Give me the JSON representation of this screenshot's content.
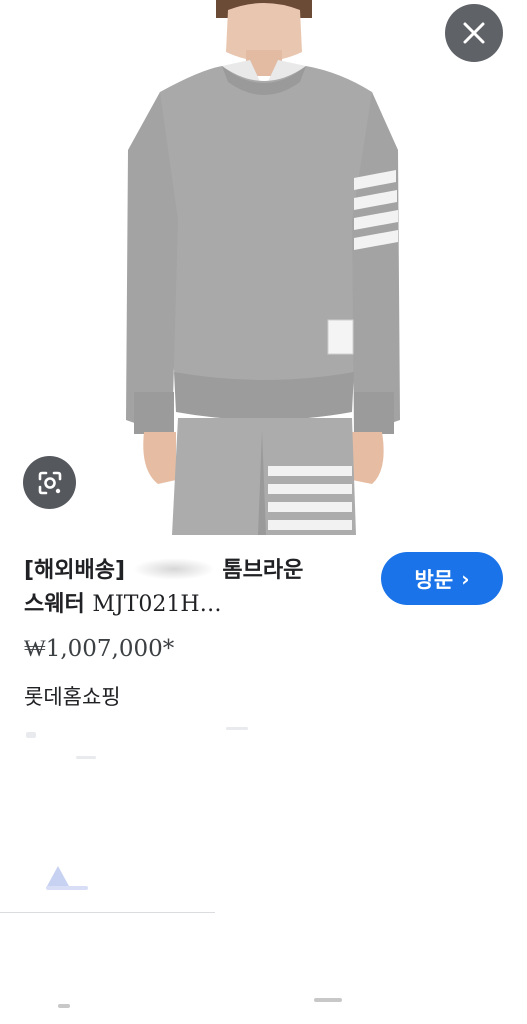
{
  "product": {
    "title_prefix": "[해외배송]",
    "brand": "톰브라운",
    "title_line2_korean": "스웨터",
    "title_line2_code": "MJT021H…",
    "price": "₩1,007,000*",
    "seller": "롯데홈쇼핑"
  },
  "actions": {
    "visit_label": "방문",
    "visit_chevron": "›"
  },
  "icons": {
    "close": "close-icon",
    "lens": "lens-icon"
  },
  "colors": {
    "visit_button": "#1a73e8",
    "close_button": "#5f6368",
    "lens_button": "#55595e"
  }
}
